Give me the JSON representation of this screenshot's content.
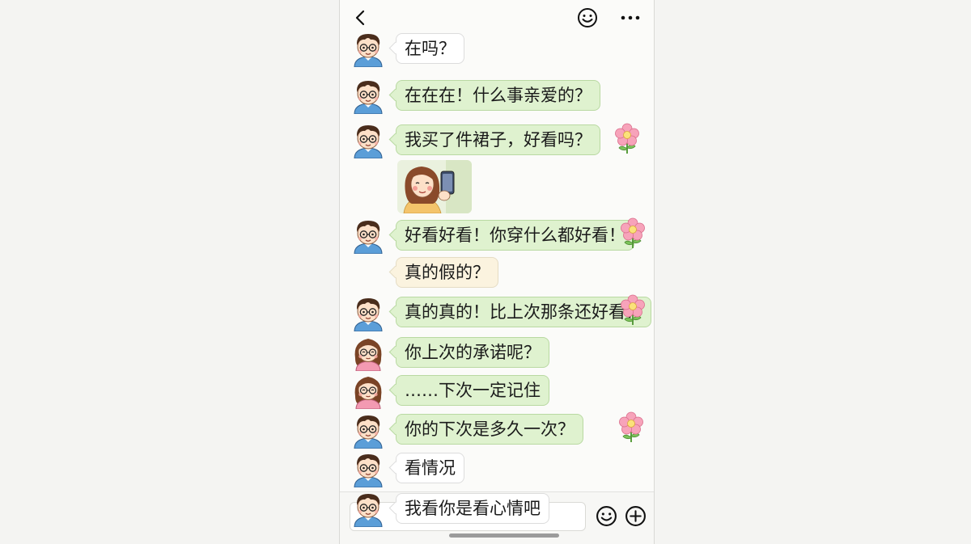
{
  "header": {
    "back_icon": "chevron-left-icon",
    "emoji_icon": "smiley-icon",
    "more_icon": "more-dots-icon"
  },
  "messages": [
    {
      "text": "在吗？",
      "style": "white",
      "avatar": "boy"
    },
    {
      "text": "在在在！什么事亲爱的？",
      "style": "green",
      "avatar": "boy"
    },
    {
      "text": "我买了件裙子，好看吗？",
      "style": "green",
      "avatar": "boy",
      "sticker": "flower-icon"
    },
    {
      "image": "girl-selfie-photo"
    },
    {
      "text": "好看好看！你穿什么都好看！",
      "style": "green",
      "avatar": "boy",
      "sticker": "flower-icon"
    },
    {
      "text": "真的假的？",
      "style": "cream"
    },
    {
      "text": "真的真的！比上次那条还好看！",
      "style": "green",
      "avatar": "boy",
      "sticker": "flower-icon"
    },
    {
      "text": "你上次的承诺呢？",
      "style": "green",
      "avatar": "girl"
    },
    {
      "text": "……下次一定记住",
      "style": "green",
      "avatar": "girl"
    },
    {
      "text": "你的下次是多久一次？",
      "style": "green",
      "avatar": "boy",
      "sticker": "flower-icon"
    },
    {
      "text": "看情况",
      "style": "white",
      "avatar": "boy"
    },
    {
      "text": "我看你是看心情吧",
      "style": "white",
      "avatar": "boy"
    }
  ],
  "input_bar": {
    "placeholder": "",
    "emoji_icon": "smiley-icon",
    "add_icon": "plus-circle-icon"
  },
  "colors": {
    "green_bubble": "#dff2cf",
    "white_bubble": "#ffffff",
    "cream_bubble": "#fbf3df",
    "flower_pink": "#f48aa6",
    "shirt_blue": "#5b9ed8"
  }
}
